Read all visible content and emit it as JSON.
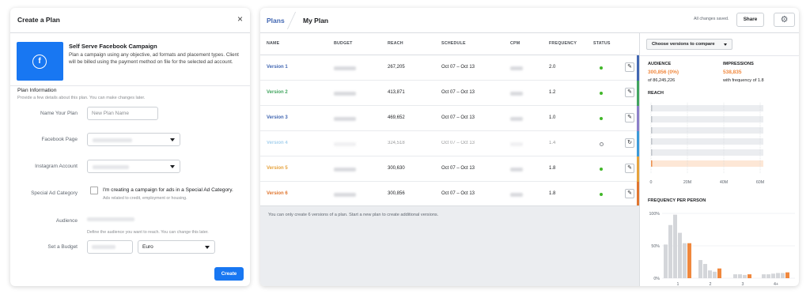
{
  "modal": {
    "title": "Create a Plan",
    "close_icon": "×",
    "campaign": {
      "title": "Self Serve Facebook Campaign",
      "description": "Plan a campaign using any objective, ad formats and placement types. Client will be billed using the payment method on file for the selected ad account.",
      "icon": "facebook-logo"
    },
    "section_title": "Plan Information",
    "section_subtitle": "Provide a few details about this plan. You can make changes later.",
    "fields": {
      "name_label": "Name Your Plan",
      "name_placeholder": "New Plan Name",
      "facebook_page_label": "Facebook Page",
      "instagram_label": "Instagram Account",
      "special_ad_label": "Special Ad Category",
      "special_ad_checkbox": "I'm creating a campaign for ads in a Special Ad Category.",
      "special_ad_sub": "Ads related to credit, employment or housing.",
      "audience_label": "Audience",
      "audience_sub": "Define the audience you want to reach. You can change this later.",
      "budget_label": "Set a Budget",
      "currency": "Euro"
    },
    "create_label": "Create"
  },
  "plan": {
    "breadcrumb_root": "Plans",
    "title": "My Plan",
    "saved_status": "All changes saved.",
    "share_label": "Share",
    "settings_icon": "⚙",
    "columns": [
      "NAME",
      "BUDGET",
      "REACH",
      "SCHEDULE",
      "CPM",
      "FREQUENCY",
      "STATUS"
    ],
    "rows": [
      {
        "name": "Version 1",
        "reach": "267,205",
        "schedule": "Oct 07 – Oct 13",
        "frequency": "2.0",
        "color": "#4267b2",
        "accent": "#4267b2",
        "status": "active",
        "action": "✎"
      },
      {
        "name": "Version 2",
        "reach": "413,871",
        "schedule": "Oct 07 – Oct 13",
        "frequency": "1.2",
        "color": "#42a55f",
        "accent": "#42a55f",
        "status": "active",
        "action": "✎"
      },
      {
        "name": "Version 3",
        "reach": "469,652",
        "schedule": "Oct 07 – Oct 13",
        "frequency": "1.0",
        "color": "#4267b2",
        "accent": "#8b7fc9",
        "status": "active",
        "action": "✎"
      },
      {
        "name": "Version 4",
        "reach": "324,518",
        "schedule": "Oct 07 – Oct 13",
        "frequency": "1.4",
        "color": "#3b9ad9",
        "accent": "#3b9ad9",
        "status": "inactive",
        "action": "↻"
      },
      {
        "name": "Version 5",
        "reach": "300,630",
        "schedule": "Oct 07 – Oct 13",
        "frequency": "1.8",
        "color": "#e6a23c",
        "accent": "#e6a23c",
        "status": "active",
        "action": "✎"
      },
      {
        "name": "Version 6",
        "reach": "300,856",
        "schedule": "Oct 07 – Oct 13",
        "frequency": "1.8",
        "color": "#e0762f",
        "accent": "#e0762f",
        "status": "active",
        "action": "✎"
      }
    ],
    "footer_note": "You can only create 6 versions of a plan. Start a new plan to create additional versions."
  },
  "side": {
    "compare_label": "Choose versions to compare",
    "audience_label": "AUDIENCE",
    "audience_value": "300,856 (0%)",
    "audience_sub": "of 86,245,226",
    "impressions_label": "IMPRESSIONS",
    "impressions_value": "538,835",
    "impressions_sub": "with frequency of 1.8",
    "reach_label": "REACH",
    "freq_label": "FREQUENCY PER PERSON"
  },
  "colors": {
    "accent_blue": "#1877f2",
    "orange": "#f0883e",
    "green_status": "#42b72a",
    "gray_bar": "#e4e6eb"
  },
  "chart_data": [
    {
      "type": "bar",
      "title": "REACH",
      "orientation": "horizontal",
      "xlabel": "",
      "ylabel": "",
      "categories": [
        "Version 1",
        "Version 2",
        "Version 3",
        "Version 4",
        "Version 5",
        "Version 6"
      ],
      "x_ticks": [
        "0",
        "20M",
        "40M",
        "60M"
      ],
      "xlim": [
        0,
        60000000
      ],
      "series": [
        {
          "values": [
            267205,
            413871,
            469652,
            324518,
            300630,
            300856
          ]
        }
      ],
      "highlight_category": "Version 6"
    },
    {
      "type": "bar",
      "title": "FREQUENCY PER PERSON",
      "xlabel": "",
      "ylabel": "",
      "categories": [
        "1",
        "2",
        "3",
        "4+"
      ],
      "y_ticks": [
        "0%",
        "50%",
        "100%"
      ],
      "ylim": [
        0,
        100
      ],
      "series": [
        {
          "values": [
            [
              52,
              82,
              98,
              70,
              54
            ],
            [
              28,
              22,
              12,
              10
            ],
            [
              6,
              6,
              5
            ],
            [
              6,
              6,
              7,
              8,
              8
            ]
          ]
        },
        {
          "values": [
            [
              54
            ],
            [
              15
            ],
            [
              6
            ],
            [
              9
            ]
          ]
        }
      ]
    }
  ]
}
